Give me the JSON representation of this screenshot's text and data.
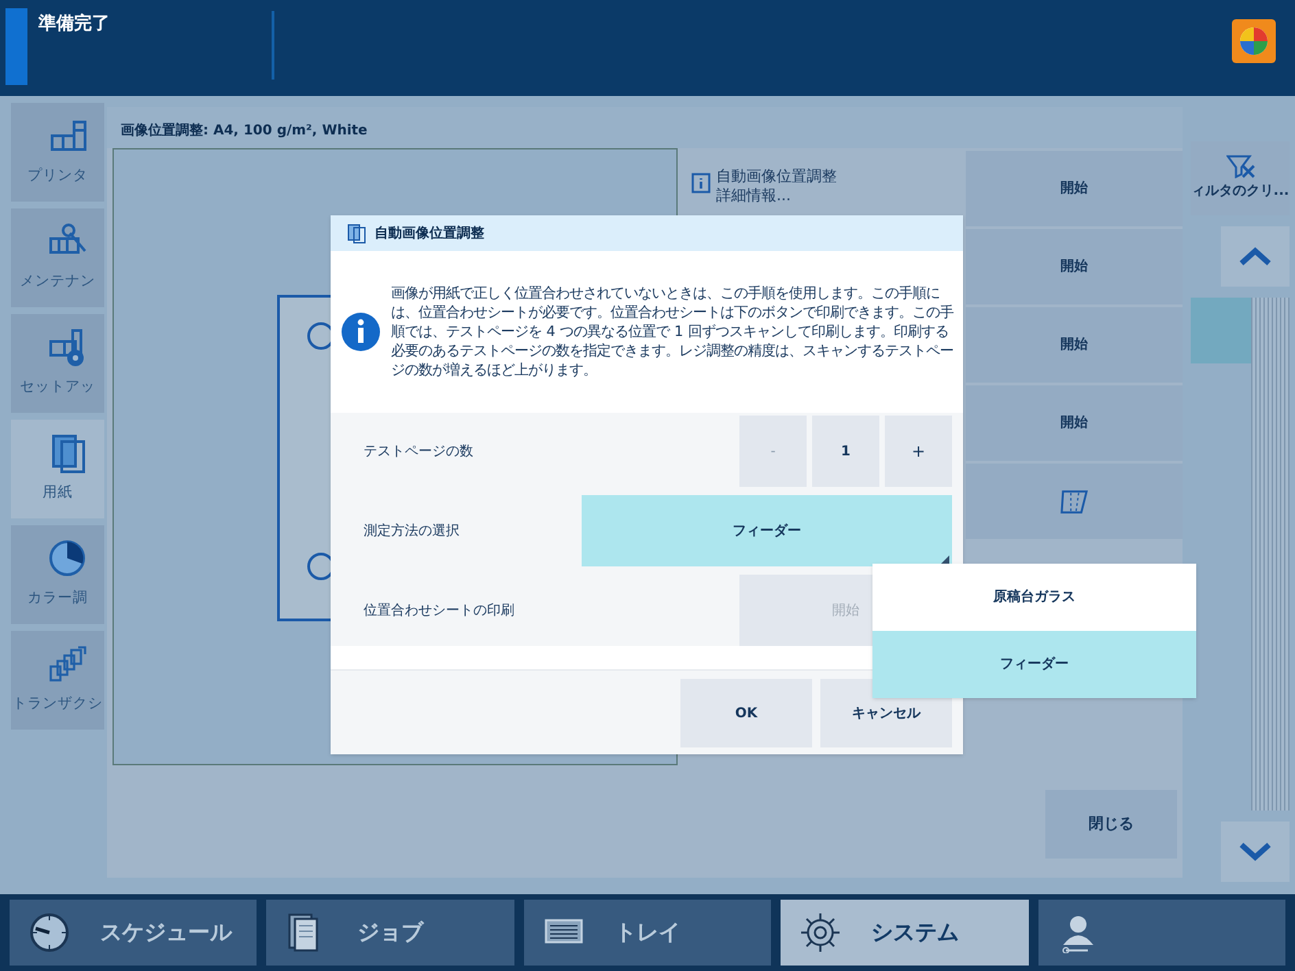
{
  "status_bar": {
    "status": "準備完了"
  },
  "sidebar": {
    "items": [
      {
        "label": "プリンタ",
        "kind": "printer",
        "selected": false
      },
      {
        "label": "メンテナン",
        "kind": "maintenance",
        "selected": false
      },
      {
        "label": "セットアッ",
        "kind": "setup",
        "selected": false
      },
      {
        "label": "用紙",
        "kind": "paper",
        "selected": true
      },
      {
        "label": "カラー調",
        "kind": "color",
        "selected": false
      },
      {
        "label": "トランザクシ",
        "kind": "transaction",
        "selected": false
      }
    ]
  },
  "panel": {
    "title": "画像位置調整: A4, 100 g/m², White",
    "info_link": [
      "自動画像位置調整",
      "詳細情報..."
    ],
    "actions": [
      {
        "kind": "text",
        "label": "開始"
      },
      {
        "kind": "text",
        "label": "開始"
      },
      {
        "kind": "text",
        "label": "開始"
      },
      {
        "kind": "text",
        "label": "開始"
      },
      {
        "kind": "icon"
      }
    ],
    "filter_button": "ィルタのクリ...",
    "close_button": "閉じる"
  },
  "dialog": {
    "title": "自動画像位置調整",
    "message": "画像が用紙で正しく位置合わせされていないときは、この手順を使用します。この手順には、位置合わせシートが必要です。位置合わせシートは下のボタンで印刷できます。この手順では、テストページを 4 つの異なる位置で 1 回ずつスキャンして印刷します。印刷する必要のあるテストページの数を指定できます。レジ調整の精度は、スキャンするテストページの数が増えるほど上がります。",
    "rows": [
      {
        "kind": "stepper",
        "label": "テストページの数",
        "minus": "-",
        "value": "1",
        "plus": "+"
      },
      {
        "kind": "select",
        "label": "測定方法の選択",
        "value": "フィーダー",
        "expanded": true
      },
      {
        "kind": "button",
        "label": "位置合わせシートの印刷",
        "button": "開始",
        "disabled": true
      }
    ],
    "buttons": [
      "OK",
      "キャンセル"
    ]
  },
  "dropdown": {
    "options": [
      {
        "label": "原稿台ガラス",
        "selected": false
      },
      {
        "label": "フィーダー",
        "selected": true
      }
    ]
  },
  "nav": {
    "tabs": [
      {
        "label": "スケジュール",
        "kind": "clock",
        "selected": false
      },
      {
        "label": "ジョブ",
        "kind": "jobs",
        "selected": false
      },
      {
        "label": "トレイ",
        "kind": "tray",
        "selected": false
      },
      {
        "label": "システム",
        "kind": "gear",
        "selected": true
      },
      {
        "kind": "user",
        "selected": false
      }
    ]
  }
}
